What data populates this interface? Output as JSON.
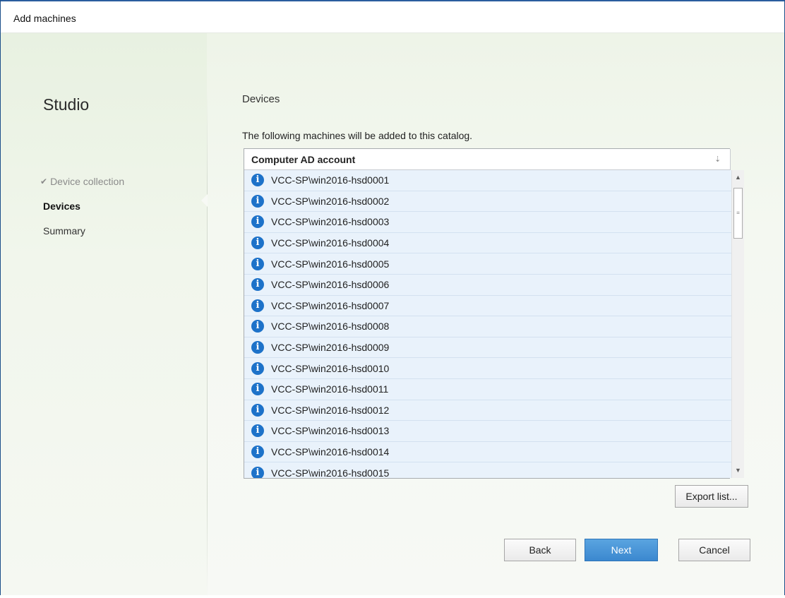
{
  "window": {
    "title": "Add machines"
  },
  "sidebar": {
    "app_name": "Studio",
    "steps": [
      {
        "label": "Device collection",
        "state": "done"
      },
      {
        "label": "Devices",
        "state": "active"
      },
      {
        "label": "Summary",
        "state": "pending"
      }
    ]
  },
  "main": {
    "heading": "Devices",
    "description": "The following machines will be added to this catalog.",
    "table": {
      "column_header": "Computer AD account",
      "sort_icon": "sort-descending-icon",
      "row_icon": "info-icon",
      "rows": [
        "VCC-SP\\win2016-hsd0001",
        "VCC-SP\\win2016-hsd0002",
        "VCC-SP\\win2016-hsd0003",
        "VCC-SP\\win2016-hsd0004",
        "VCC-SP\\win2016-hsd0005",
        "VCC-SP\\win2016-hsd0006",
        "VCC-SP\\win2016-hsd0007",
        "VCC-SP\\win2016-hsd0008",
        "VCC-SP\\win2016-hsd0009",
        "VCC-SP\\win2016-hsd0010",
        "VCC-SP\\win2016-hsd0011",
        "VCC-SP\\win2016-hsd0012",
        "VCC-SP\\win2016-hsd0013",
        "VCC-SP\\win2016-hsd0014",
        "VCC-SP\\win2016-hsd0015"
      ]
    },
    "export_label": "Export list..."
  },
  "footer": {
    "back_label": "Back",
    "next_label": "Next",
    "cancel_label": "Cancel"
  },
  "colors": {
    "accent": "#3b88cf",
    "row_selected": "#e9f2fb",
    "info_icon": "#1d72c9"
  }
}
